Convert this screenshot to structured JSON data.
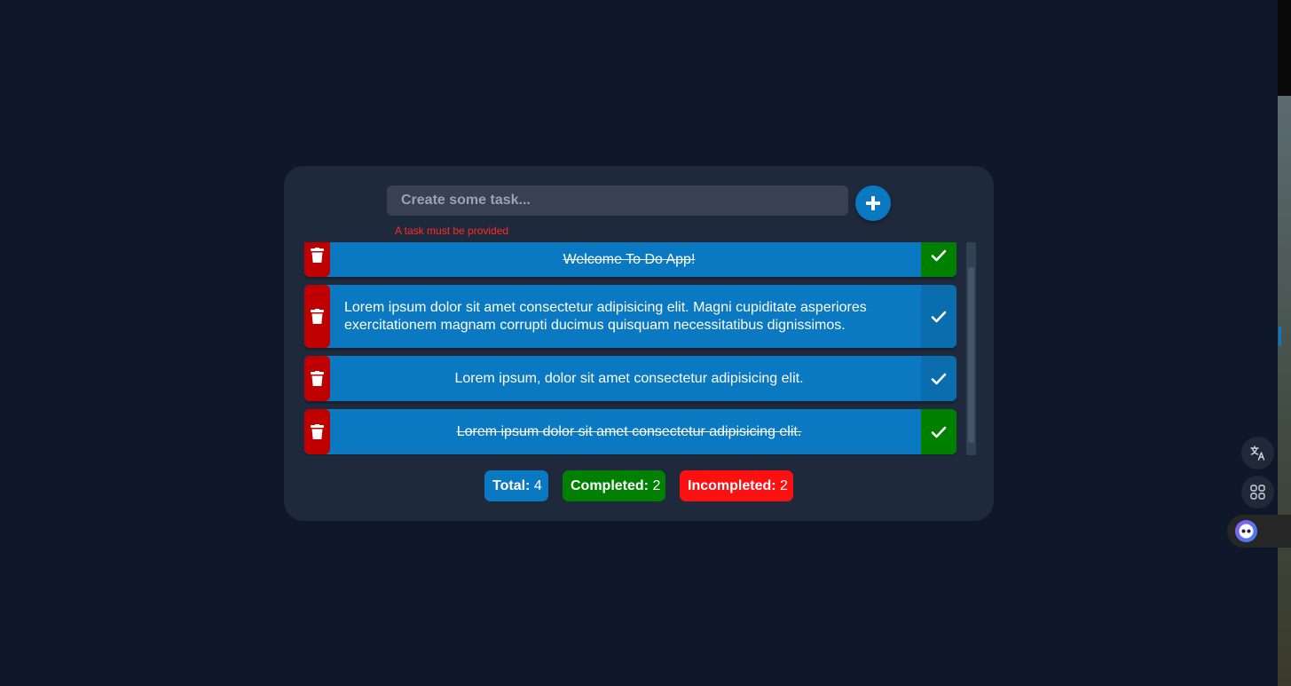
{
  "input": {
    "placeholder": "Create some task...",
    "value": ""
  },
  "error_message": "A task must be provided",
  "tasks": [
    {
      "text": "Welcome To Do App!",
      "completed": true
    },
    {
      "text": "Lorem ipsum dolor sit amet consectetur adipisicing elit. Magni cupiditate asperiores exercitationem magnam corrupti ducimus quisquam necessitatibus dignissimos.",
      "completed": false
    },
    {
      "text": "Lorem ipsum, dolor sit amet consectetur adipisicing elit.",
      "completed": false
    },
    {
      "text": "Lorem ipsum dolor sit amet consectetur adipisicing elit.",
      "completed": true
    }
  ],
  "stats": {
    "total_label": "Total:",
    "total_value": "4",
    "completed_label": "Completed:",
    "completed_value": "2",
    "incompleted_label": "Incompleted:",
    "incompleted_value": "2"
  },
  "colors": {
    "page_background": "#0f172a",
    "card_background": "#1e293b",
    "task_blue": "#0a79c2",
    "delete_red": "#c00000",
    "done_green": "#008000",
    "incompleted_red": "#ff1010",
    "error_red": "#ff2a2a"
  },
  "icons": {
    "add": "plus-icon",
    "delete": "trash-icon",
    "complete": "check-icon",
    "side_tools": [
      "translate-icon",
      "apps-grid-icon",
      "assistant-icon"
    ]
  }
}
